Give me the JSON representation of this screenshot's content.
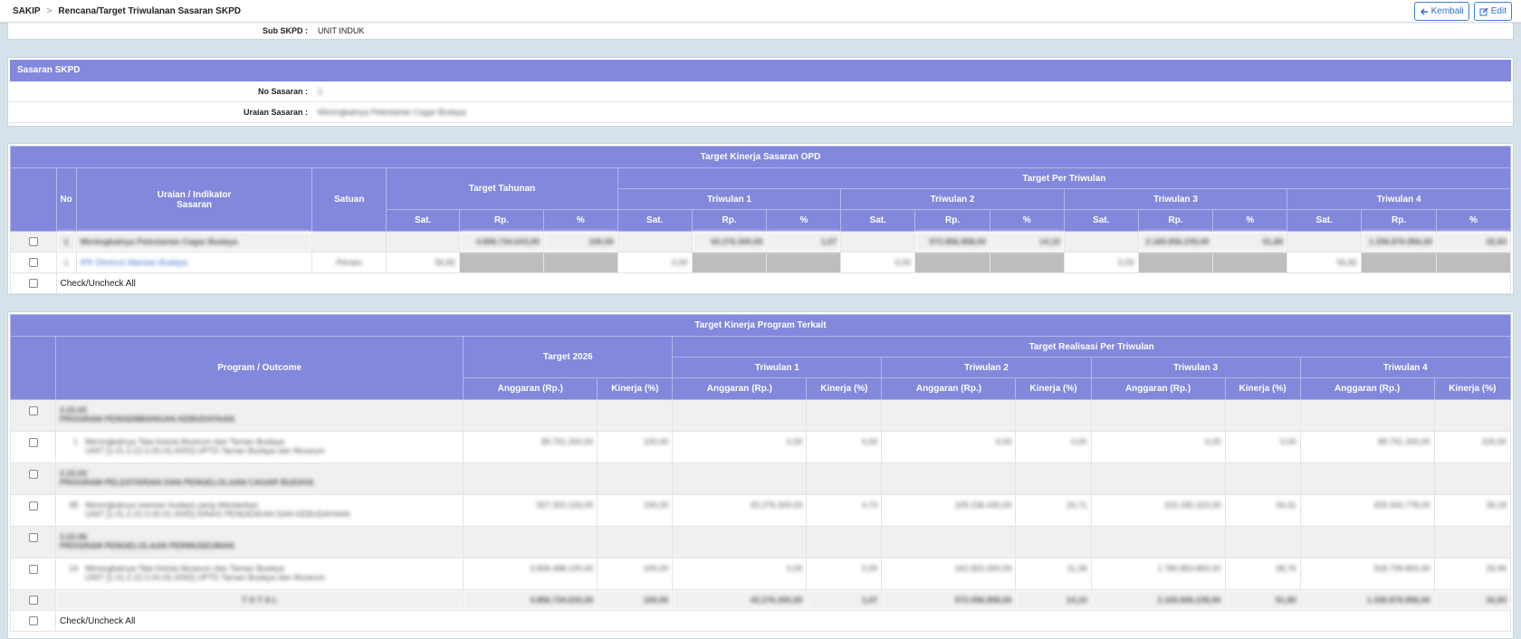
{
  "breadcrumb": {
    "root": "SAKIP",
    "separator": ">",
    "current": "Rencana/Target Triwulanan Sasaran SKPD"
  },
  "buttons": {
    "back": "Kembali",
    "edit": "Edit"
  },
  "sub_skpd": {
    "label": "Sub SKPD :",
    "value": "UNIT INDUK"
  },
  "sasaran_panel": {
    "title": "Sasaran SKPD",
    "no_label": "No Sasaran :",
    "no_value": "1",
    "uraian_label": "Uraian Sasaran :",
    "uraian_value": "Meningkatnya Pelestarian Cagar Budaya"
  },
  "target_table": {
    "title": "Target Kinerja Sasaran OPD",
    "headers": {
      "no": "No",
      "uraian": "Uraian / Indikator\nSasaran",
      "satuan": "Satuan",
      "tahunan": "Target Tahunan",
      "per_triwulan": "Target Per Triwulan",
      "triwulan": [
        "Triwulan 1",
        "Triwulan 2",
        "Triwulan 3",
        "Triwulan 4"
      ],
      "sub": [
        "Sat.",
        "Rp.",
        "%"
      ]
    },
    "rows": [
      {
        "no": "1",
        "uraian": "Meningkatnya Pelestarian Cagar Budaya",
        "satuan": "",
        "tahunan": [
          "",
          "4.856.734.633,00",
          "100,00"
        ],
        "tw": [
          [
            "",
            "43.276.300,00",
            "1,07"
          ],
          [
            "",
            "572.856.858,00",
            "14,10"
          ],
          [
            "",
            "2.165.836.235,00",
            "51,80"
          ],
          [
            "",
            "1.336.876.956,00",
            "32,83"
          ]
        ]
      },
      {
        "no": "1",
        "uraian": "IPK Dimensi Warisan Budaya",
        "satuan": "Persen",
        "tahunan": [
          "56,82",
          "",
          ""
        ],
        "tw": [
          [
            "0,00",
            "",
            ""
          ],
          [
            "0,00",
            "",
            ""
          ],
          [
            "0,00",
            "",
            ""
          ],
          [
            "56,82",
            "",
            ""
          ]
        ]
      }
    ],
    "check_all": "Check/Uncheck All"
  },
  "program_table": {
    "title": "Target Kinerja Program Terkait",
    "headers": {
      "program": "Program / Outcome",
      "target_year": "Target 2026",
      "realisasi": "Target Realisasi Per Triwulan",
      "triwulan": [
        "Triwulan 1",
        "Triwulan 2",
        "Triwulan 3",
        "Triwulan 4"
      ],
      "anggaran": "Anggaran (Rp.)",
      "kinerja": "Kinerja (%)"
    },
    "rows": [
      {
        "kind": "program",
        "code": "2.22.02",
        "name": "PROGRAM PENGEMBANGAN KEBUDAYAAN"
      },
      {
        "kind": "outcome",
        "no": "1",
        "line1": "Meningkatnya Tata Kelola Museum dan Taman Budaya",
        "line2": "UNIT [1.01.2.22.0.00.02.0000] UPTD Taman Budaya dan Museum",
        "values": [
          "89.791.200,00",
          "100,00",
          "0,00",
          "0,00",
          "0,00",
          "0,00",
          "0,00",
          "0,00",
          "89.791.200,00",
          "100,00"
        ]
      },
      {
        "kind": "program",
        "code": "2.22.03",
        "name": "PROGRAM PELESTARIAN DAN PENGELOLAAN CAGAR BUDAYA"
      },
      {
        "kind": "outcome",
        "no": "38",
        "line1": "Meningkatnya warisan budaya yang dilestarikan",
        "line2": "UNIT [1.01.2.22.0.00.01.0000] DINAS PENDIDIKAN DAN KEBUDAYAAN",
        "values": [
          "927.320.133,00",
          "100,00",
          "43.276.300,00",
          "4,70",
          "229.236.430,00",
          "24,71",
          "315.182.323,00",
          "34,41",
          "333.343.778,00",
          "36,18"
        ]
      },
      {
        "kind": "program",
        "code": "2.22.06",
        "name": "PROGRAM PENGELOLAAN PERMUSEUMAN"
      },
      {
        "kind": "outcome",
        "no": "14",
        "line1": "Meningkatnya Tata Kelola Museum dan Taman Budaya",
        "line2": "UNIT [1.01.2.22.0.00.02.0000] UPTD Taman Budaya dan Museum",
        "values": [
          "3.839.488.100,00",
          "100,00",
          "0,00",
          "0,00",
          "342.820.300,00",
          "11,28",
          "1.780.853.800,00",
          "38,76",
          "918.739.800,00",
          "29,96"
        ]
      }
    ],
    "total": {
      "label": "T O T A L",
      "values": [
        "4.856.734.633,00",
        "100,00",
        "43.276.300,00",
        "1,07",
        "572.056.858,00",
        "14,10",
        "2.165.836.235,00",
        "51,80",
        "1.336.876.956,00",
        "32,83"
      ]
    },
    "check_all": "Check/Uncheck All"
  }
}
